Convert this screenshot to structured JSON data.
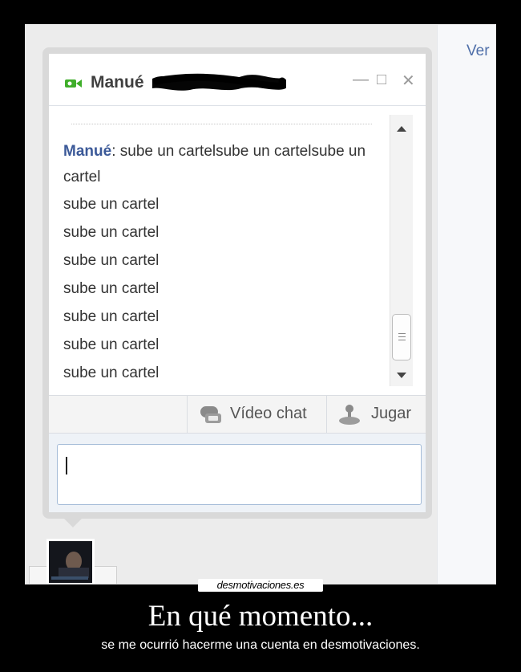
{
  "page": {
    "right_link": "Ver"
  },
  "chat": {
    "contact_name": "Manué",
    "window_controls": {
      "minimize": "—",
      "maximize": "□",
      "close": "✕"
    },
    "first_message": {
      "sender": "Manué",
      "separator": ":",
      "text": " sube un cartelsube un cartelsube un cartel"
    },
    "lines": [
      "sube un cartel",
      "sube un cartel",
      "sube un cartel",
      "sube un cartel",
      "sube un cartel",
      "sube un cartel",
      "sube un cartel"
    ],
    "actions": {
      "video_chat": "Vídeo chat",
      "game": "Jugar"
    },
    "input_value": ""
  },
  "poster": {
    "site": "desmotivaciones.es",
    "title": "En qué momento...",
    "subtitle": "se me ocurrió hacerme una cuenta en desmotivaciones."
  },
  "colors": {
    "accent": "#3b5998",
    "video_icon": "#3fae2a",
    "background": "#000000"
  }
}
